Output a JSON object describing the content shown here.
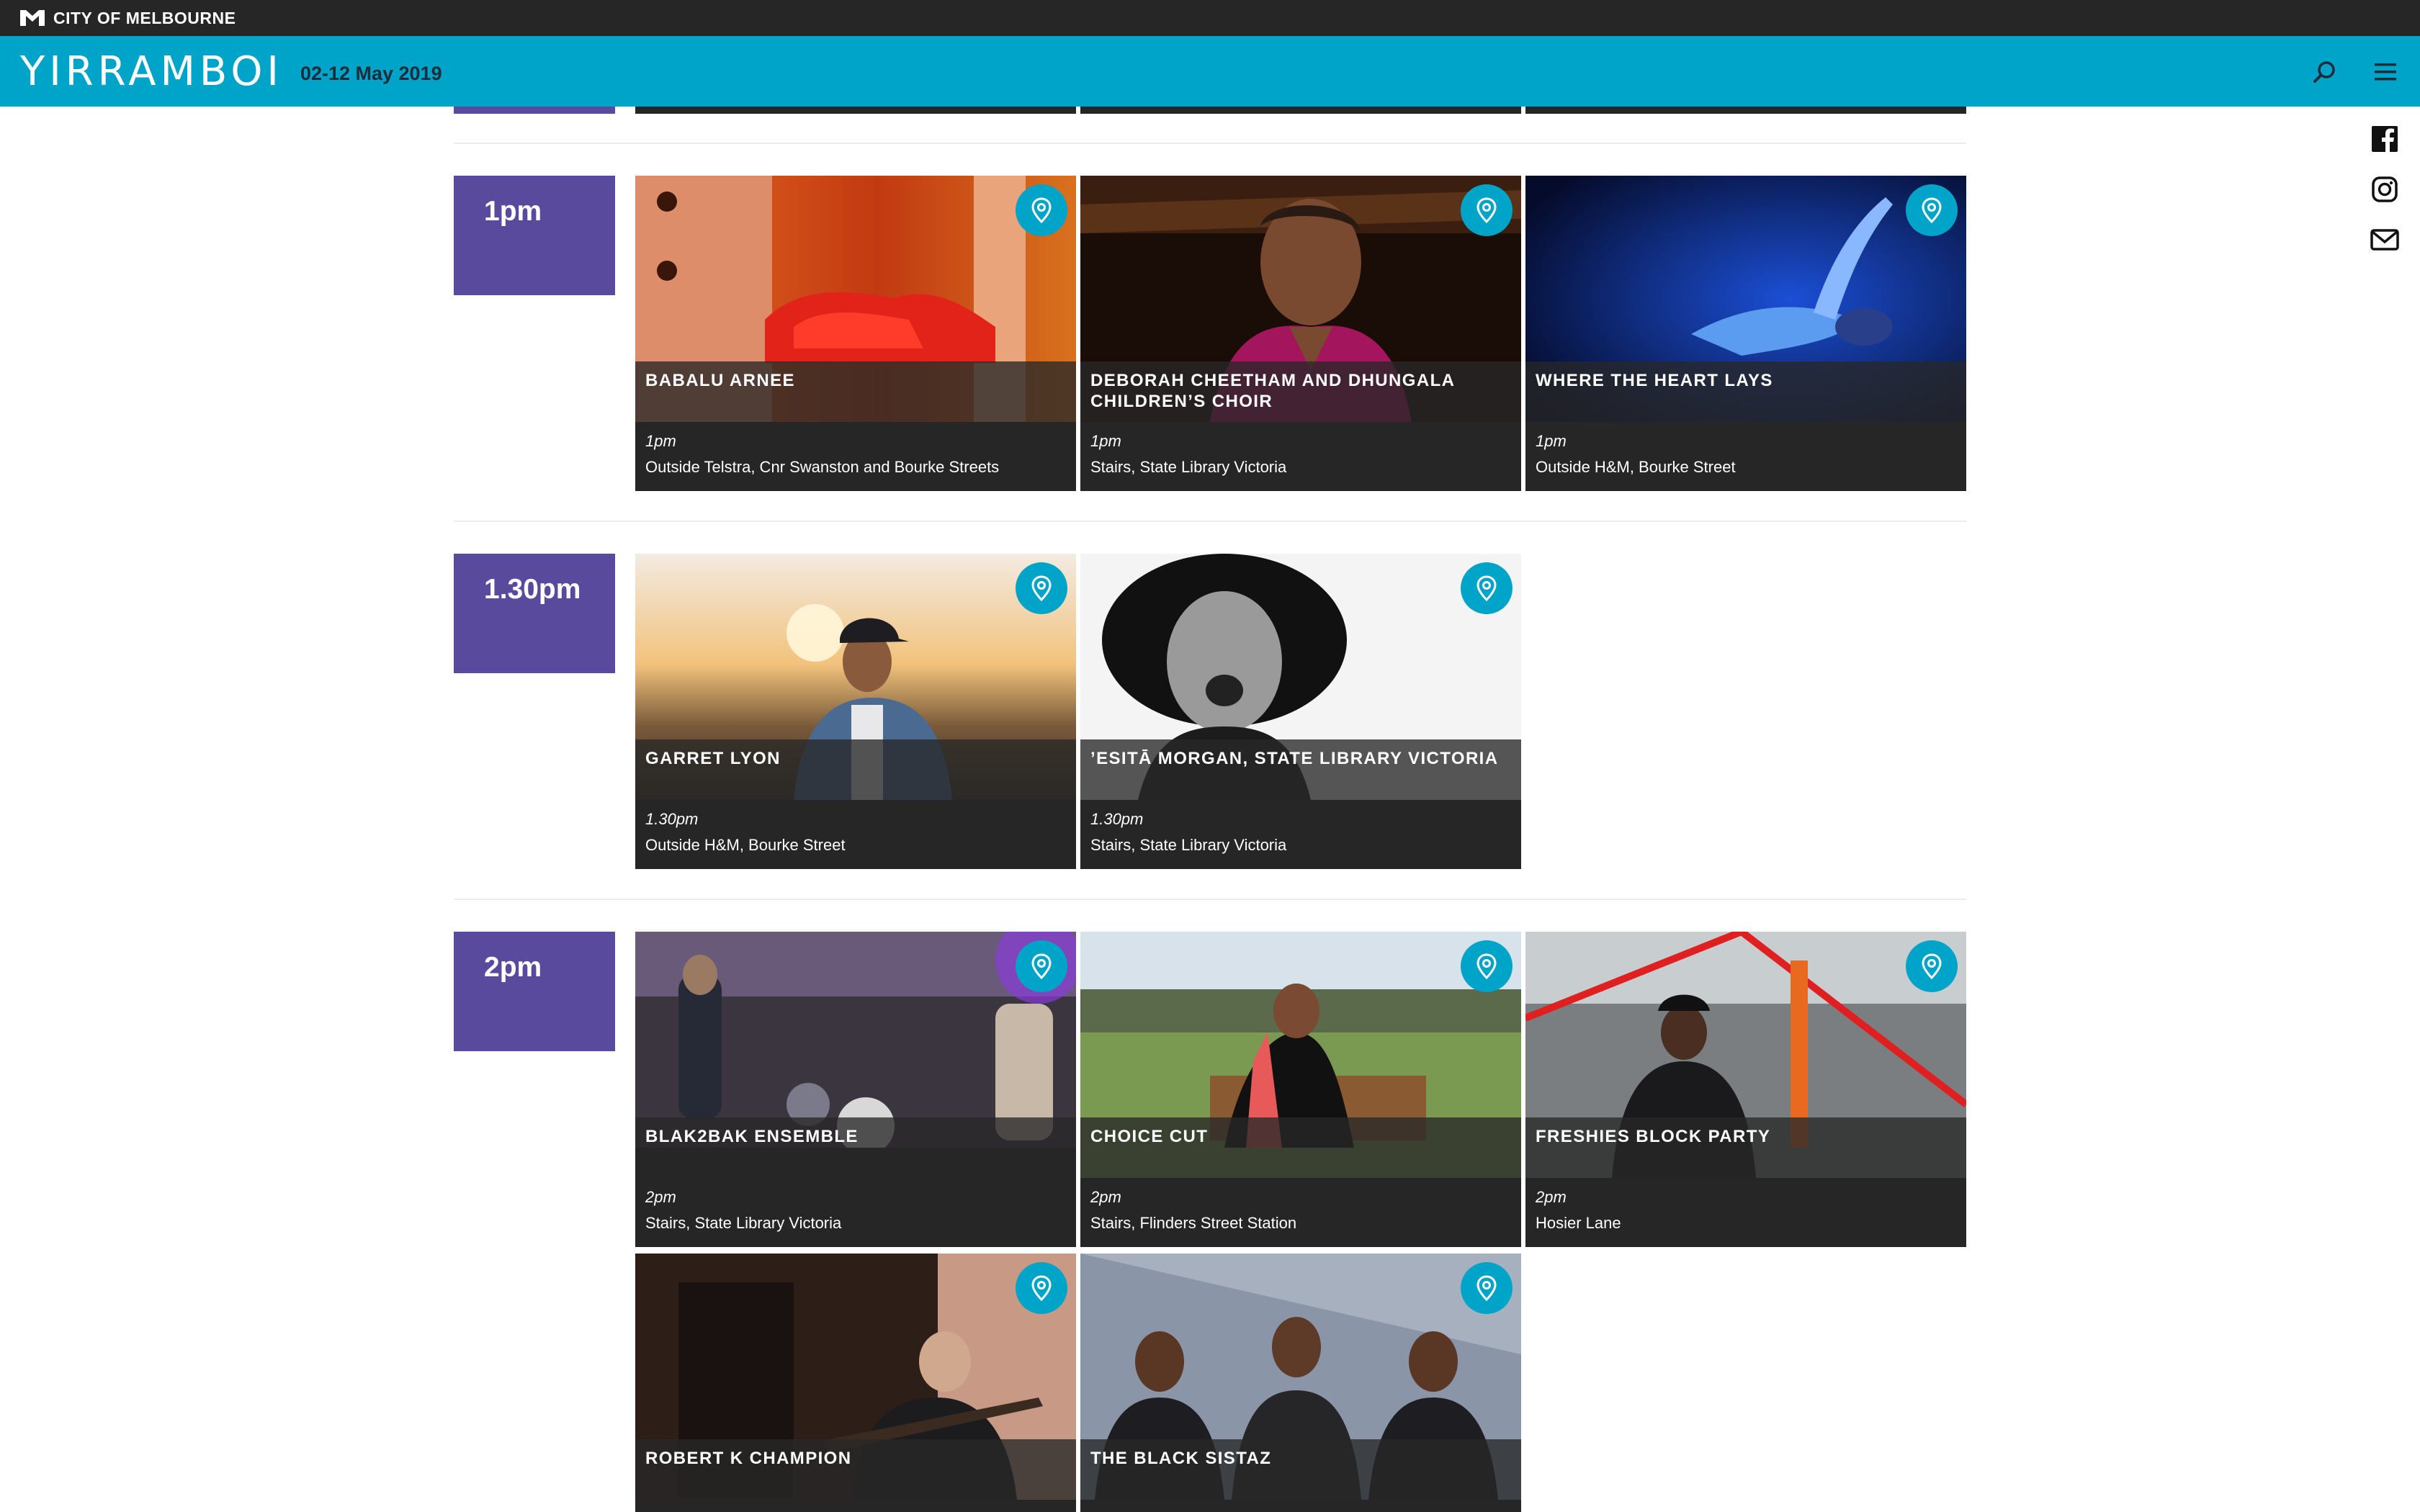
{
  "top_bar": {
    "label": "CITY OF MELBOURNE"
  },
  "header": {
    "brand": "YIRRAMBOI",
    "dates": "02-12 May 2019",
    "search_icon": "search-icon",
    "menu_icon": "hamburger-menu-icon"
  },
  "social": [
    "facebook-icon",
    "instagram-icon",
    "mail-icon"
  ],
  "colors": {
    "accent": "#00a4c8",
    "time_block": "#5a4a9e",
    "card": "#262626",
    "top_bar": "#262626"
  },
  "sessions": [
    {
      "time": "1pm",
      "events": [
        {
          "title": "BABALU ARNEE",
          "time": "1pm",
          "venue": "Outside Telstra, Cnr Swanston and Bourke Streets"
        },
        {
          "title": "DEBORAH CHEETHAM AND DHUNGALA CHILDREN’S CHOIR",
          "time": "1pm",
          "venue": "Stairs, State Library Victoria"
        },
        {
          "title": "WHERE THE HEART LAYS",
          "time": "1pm",
          "venue": "Outside H&M, Bourke Street"
        }
      ]
    },
    {
      "time": "1.30pm",
      "events": [
        {
          "title": "GARRET LYON",
          "time": "1.30pm",
          "venue": "Outside H&M, Bourke Street"
        },
        {
          "title": "’ESITĀ MORGAN, STATE LIBRARY VICTORIA",
          "time": "1.30pm",
          "venue": "Stairs, State Library Victoria"
        }
      ]
    },
    {
      "time": "2pm",
      "events": [
        {
          "title": "BLAK2BAK ENSEMBLE",
          "time": "2pm",
          "venue": "Stairs, State Library Victoria"
        },
        {
          "title": "CHOICE CUT",
          "time": "2pm",
          "venue": "Stairs, Flinders Street Station"
        },
        {
          "title": "FRESHIES BLOCK PARTY",
          "time": "2pm",
          "venue": "Hosier Lane"
        },
        {
          "title": "ROBERT K CHAMPION",
          "time": "",
          "venue": ""
        },
        {
          "title": "THE BLACK SISTAZ",
          "time": "",
          "venue": ""
        }
      ]
    }
  ]
}
